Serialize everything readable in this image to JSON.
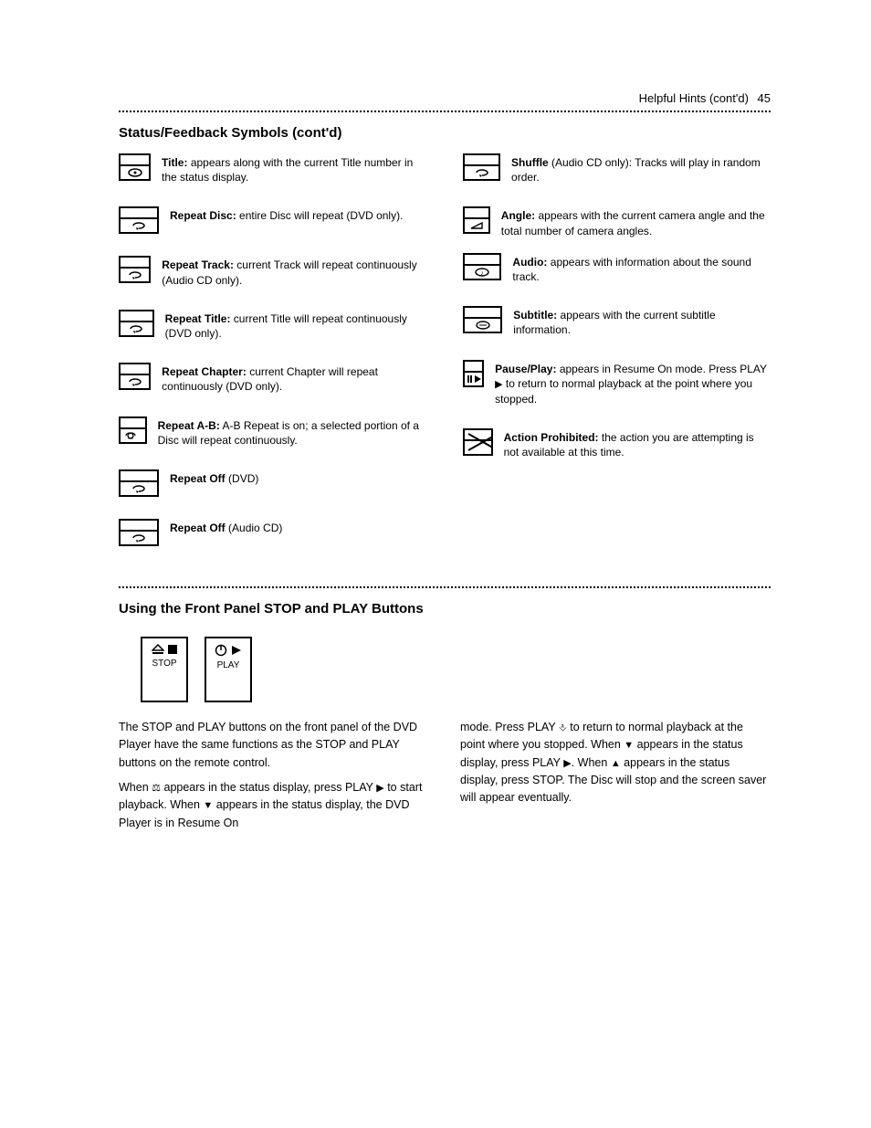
{
  "header": {
    "title": "Helpful Hints (cont'd)",
    "page_number": "45"
  },
  "section1": {
    "title": "Status/Feedback Symbols (cont'd)",
    "left": [
      {
        "name": "Title:",
        "desc": "appears along with the current Title number in the status display.",
        "icon": "title"
      },
      {
        "name": "Repeat Disc:",
        "desc": "entire Disc will repeat (DVD only).",
        "icon": "repeat"
      },
      {
        "name": "Repeat Track:",
        "desc": "current Track will repeat continuously (Audio CD only).",
        "icon": "repeat"
      },
      {
        "name": "Repeat Title:",
        "desc": "current Title will repeat continuously (DVD only).",
        "icon": "repeat"
      },
      {
        "name": "Repeat Chapter:",
        "desc": "current Chapter will repeat continuously (DVD only).",
        "icon": "repeat"
      },
      {
        "name": "Repeat A-B:",
        "desc": "A-B Repeat is on; a selected portion of a Disc will repeat continuously.",
        "icon": "repeat-ab"
      },
      {
        "name": "Repeat Off",
        "desc": "(DVD)",
        "icon": "repeat"
      },
      {
        "name": "Repeat Off",
        "desc": "(Audio CD)",
        "icon": "repeat"
      }
    ],
    "right": [
      {
        "name": "Shuffle",
        "desc": "(Audio CD only): Tracks will play in random order.",
        "icon": "shuffle"
      },
      {
        "name": "Angle:",
        "desc": "appears with the current camera angle and the total number of camera angles.",
        "icon": "angle"
      },
      {
        "name": "Audio:",
        "desc": "appears with information about the sound track.",
        "icon": "audio"
      },
      {
        "name": "Subtitle:",
        "desc": "appears with the current subtitle information.",
        "icon": "subtitle"
      },
      {
        "name": "Pause/Play:",
        "desc": "appears in Resume On mode. Press PLAY ",
        "post": " to return to normal playback at the point where you stopped.",
        "icon": "pauseplay",
        "inline_glyph": "▶"
      },
      {
        "name": "Action Prohibited:",
        "desc": "the action you are attempting is not available at this time.",
        "icon": "prohibited"
      }
    ]
  },
  "section2": {
    "title": "Using the Front Panel STOP and PLAY Buttons",
    "btn_stop": {
      "label": "STOP"
    },
    "btn_play": {
      "label": "PLAY"
    },
    "col1": [
      "The STOP and PLAY buttons on the front panel of the DVD Player have the same functions as the STOP and PLAY buttons on the remote control.",
      "When   appears in the status display, press PLAY   to start playback. When   appears in the status display, the DVD Player is in Resume On"
    ],
    "col2": [
      "mode. Press PLAY   to return to normal playback at the point where you stopped. When   appears in the status display, press PLAY   . When   appears in the status display, press STOP. The Disc will stop and the screen saver will appear eventually."
    ],
    "glyphs": {
      "stop_icon": "⏏■",
      "play_icon": "⦿▶",
      "weight": "⚖",
      "play_small": "▶",
      "down": "▼",
      "tool": "⎀",
      "up": "▲"
    }
  }
}
